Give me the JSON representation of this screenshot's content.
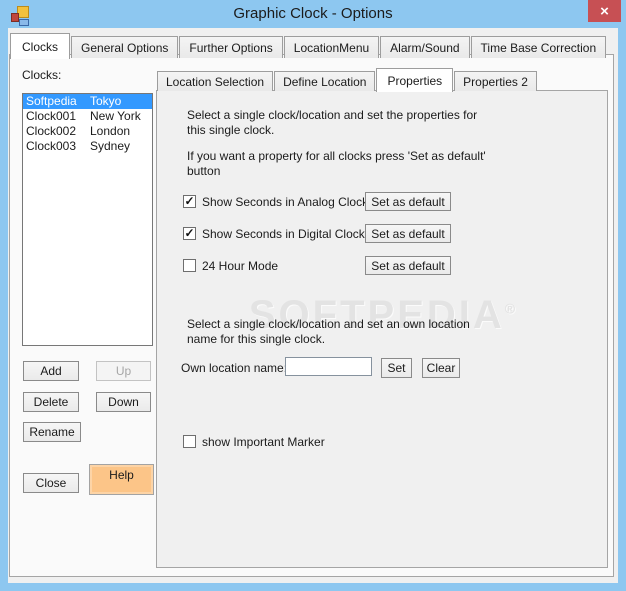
{
  "window": {
    "title": "Graphic Clock - Options",
    "close_glyph": "×"
  },
  "outer_tabs": [
    {
      "label": "Clocks"
    },
    {
      "label": "General Options"
    },
    {
      "label": "Further Options"
    },
    {
      "label": "LocationMenu"
    },
    {
      "label": "Alarm/Sound"
    },
    {
      "label": "Time Base Correction"
    }
  ],
  "clocks_panel": {
    "label": "Clocks:",
    "items": [
      {
        "name": "Softpedia",
        "city": "Tokyo"
      },
      {
        "name": "Clock001",
        "city": "New York"
      },
      {
        "name": "Clock002",
        "city": "London"
      },
      {
        "name": "Clock003",
        "city": "Sydney"
      }
    ],
    "buttons": {
      "add": "Add",
      "up": "Up",
      "delete": "Delete",
      "down": "Down",
      "rename": "Rename",
      "close": "Close",
      "help": "Help"
    }
  },
  "inner_tabs": [
    {
      "label": "Location Selection"
    },
    {
      "label": "Define Location"
    },
    {
      "label": "Properties"
    },
    {
      "label": "Properties 2"
    }
  ],
  "properties": {
    "intro1": "Select a single clock/location and set the properties for this single clock.",
    "intro2": "If you want a property for all clocks press 'Set as default' button",
    "options": [
      {
        "label": "Show Seconds in Analog Clock",
        "mark": "✓",
        "button": "Set as default"
      },
      {
        "label": "Show Seconds in Digital Clock",
        "mark": "✓",
        "button": "Set as default"
      },
      {
        "label": "24 Hour Mode",
        "mark": "",
        "button": "Set as default"
      }
    ],
    "own_location": {
      "intro": "Select a single clock/location and set an own location name for this single clock.",
      "label": "Own location name:",
      "value": "",
      "set": "Set",
      "clear": "Clear"
    },
    "marker": {
      "label": "show Important Marker",
      "mark": ""
    },
    "watermark": {
      "text": "SOFTPEDIA",
      "reg": "®"
    },
    "accent_colors": {
      "titlebar_blue": "#8dc7f0",
      "close_red": "#c75054",
      "help_orange": "#fcc588",
      "selection_blue": "#3399ff"
    }
  }
}
